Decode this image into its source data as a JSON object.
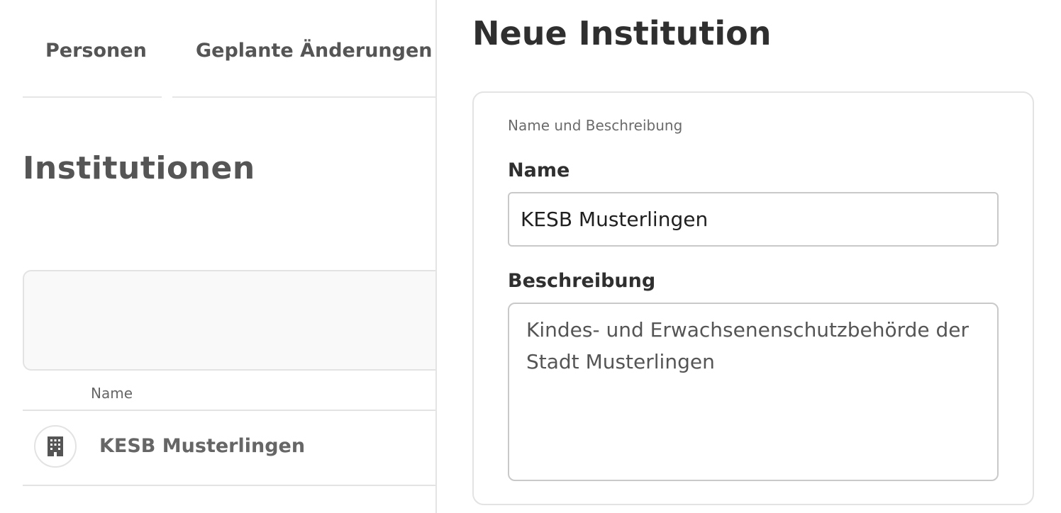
{
  "tabs": [
    {
      "label": "Personen"
    },
    {
      "label": "Geplante Änderungen"
    }
  ],
  "page": {
    "title": "Institutionen"
  },
  "table": {
    "columns": [
      "Name"
    ],
    "rows": [
      {
        "name": "KESB Musterlingen",
        "icon": "building-icon"
      }
    ]
  },
  "drawer": {
    "title": "Neue Institution",
    "section_label": "Name und Beschreibung",
    "name_label": "Name",
    "name_value": "KESB Musterlingen",
    "description_label": "Beschreibung",
    "description_value": "Kindes- und Erwachsenenschutzbehörde der Stadt Musterlingen"
  },
  "colors": {
    "border": "#e3e3e3",
    "input_border": "#c9c9c9",
    "text_dark": "#2f2f2f",
    "text_muted": "#666666"
  }
}
